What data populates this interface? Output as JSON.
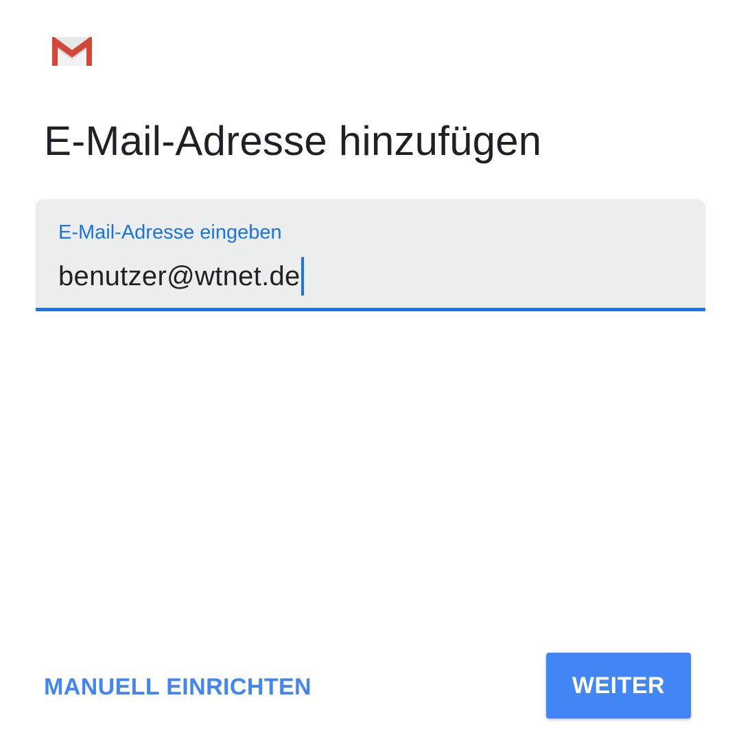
{
  "app": {
    "logo_icon": "gmail-logo-icon"
  },
  "header": {
    "title": "E-Mail-Adresse hinzufügen"
  },
  "email_field": {
    "label": "E-Mail-Adresse eingeben",
    "value": "benutzer@wtnet.de",
    "state": "focused"
  },
  "actions": {
    "manual_setup_label": "MANUELL EINRICHTEN",
    "next_label": "WEITER"
  },
  "colors": {
    "accent": "#1a73e8",
    "button_blue": "#4285f4",
    "field_background": "#eceeee",
    "gmail_red": "#d93025"
  }
}
